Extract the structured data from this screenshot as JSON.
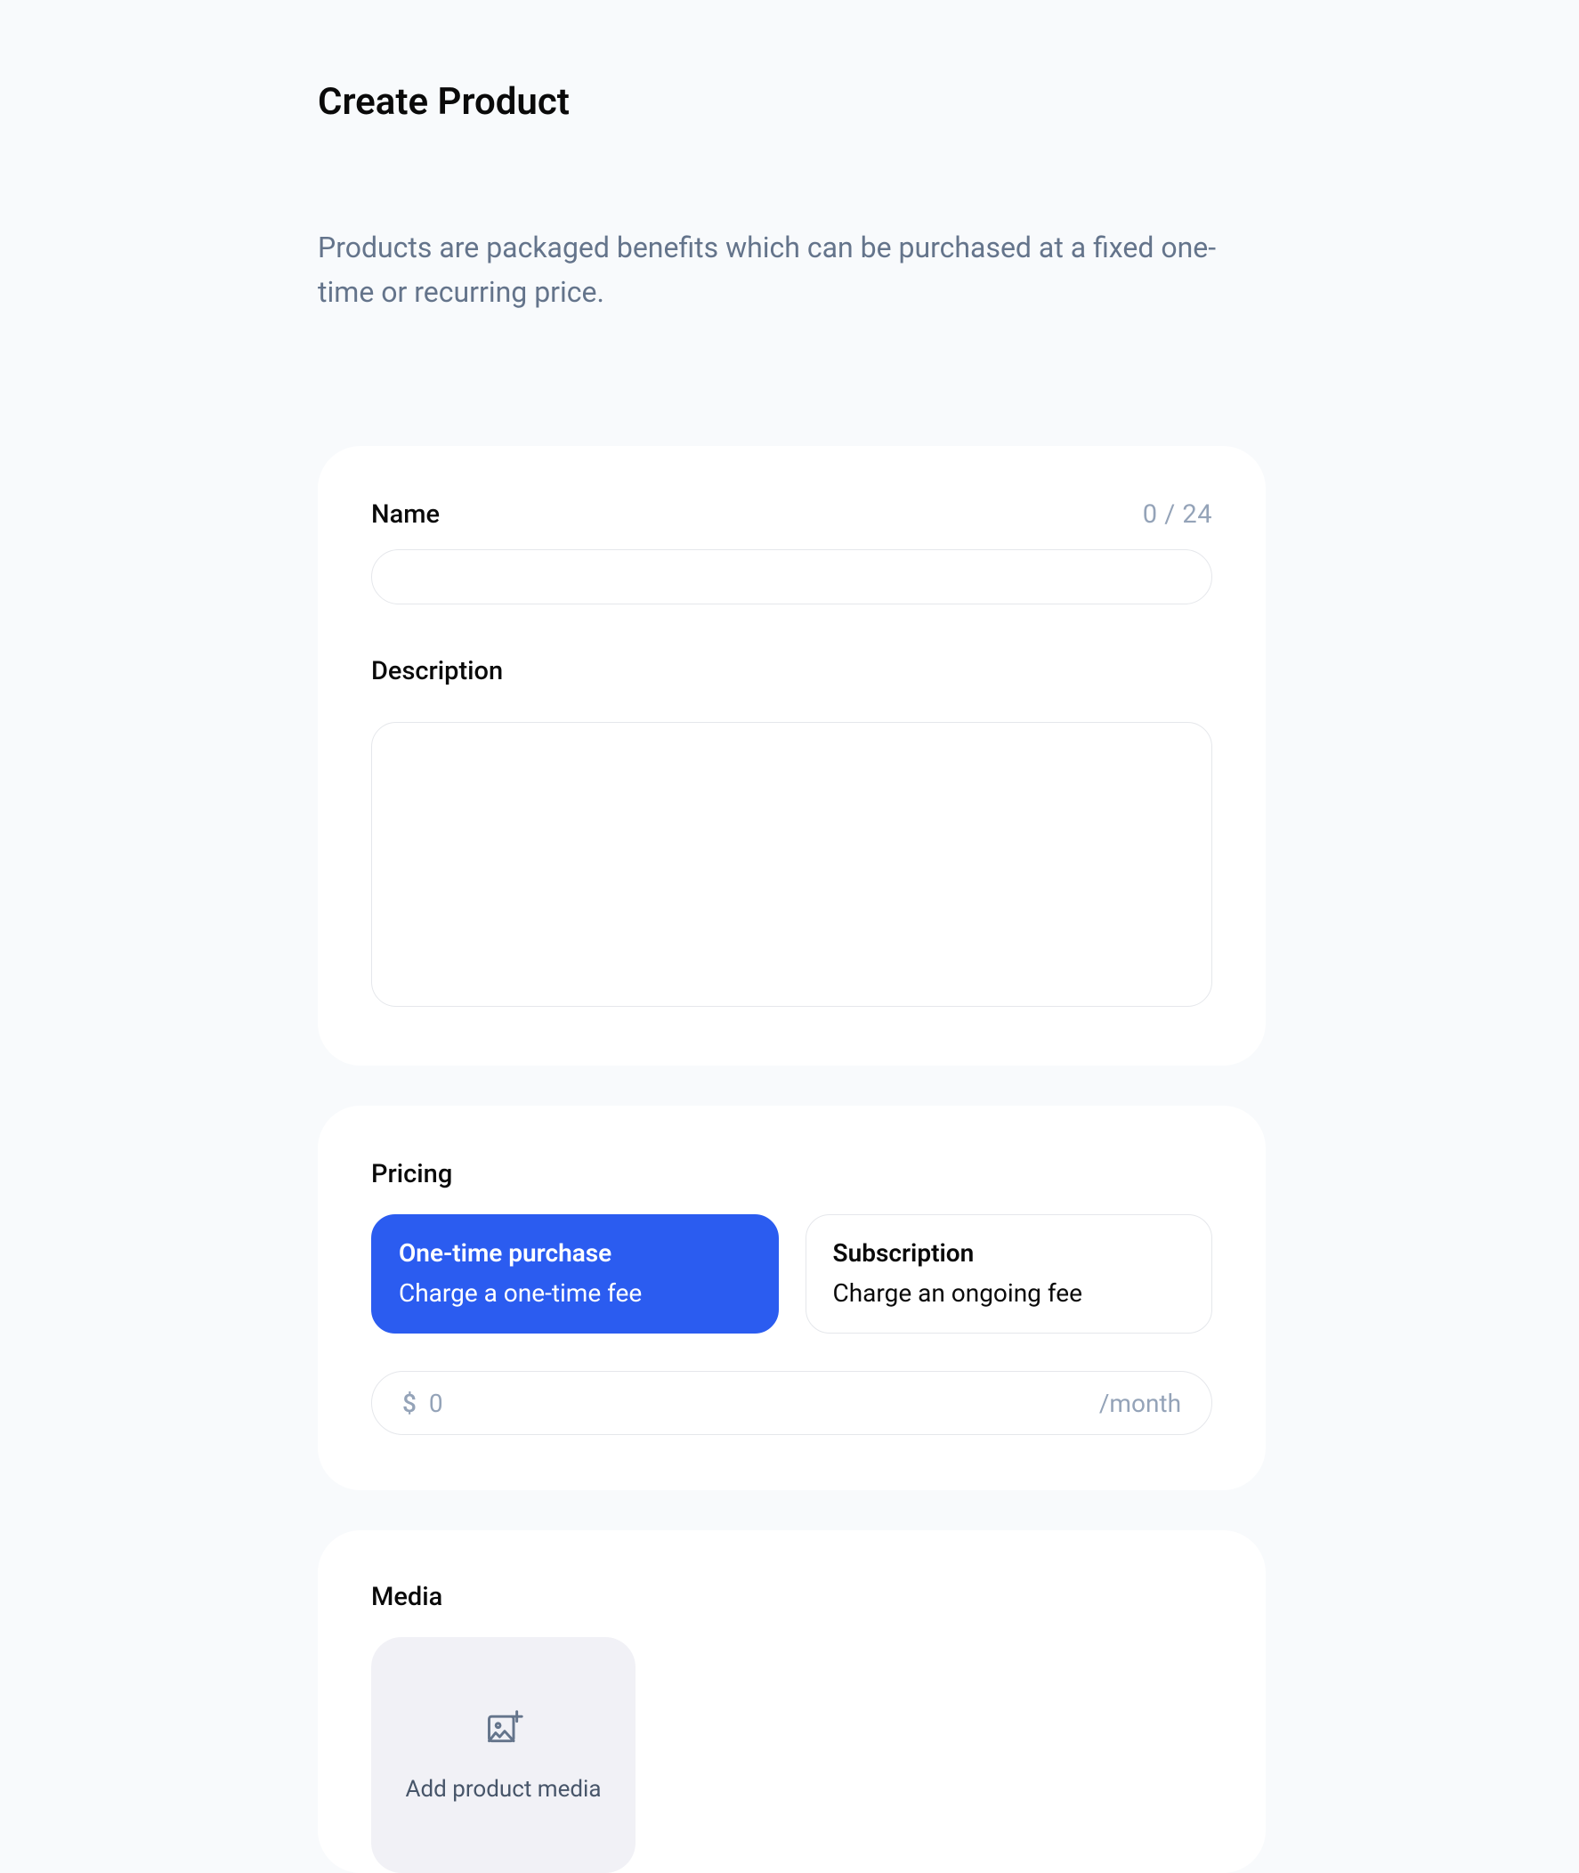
{
  "header": {
    "title": "Create Product",
    "description": "Products are packaged benefits which can be purchased at a fixed one-time or recurring price."
  },
  "basicInfo": {
    "nameLabel": "Name",
    "nameCounter": "0 / 24",
    "nameValue": "",
    "descriptionLabel": "Description",
    "descriptionValue": ""
  },
  "pricing": {
    "sectionLabel": "Pricing",
    "options": [
      {
        "title": "One-time purchase",
        "subtitle": "Charge a one-time fee",
        "selected": true
      },
      {
        "title": "Subscription",
        "subtitle": "Charge an ongoing fee",
        "selected": false
      }
    ],
    "priceCurrencySymbol": "$",
    "pricePlaceholder": "0",
    "priceValue": "",
    "priceSuffix": "/month"
  },
  "media": {
    "sectionLabel": "Media",
    "uploadText": "Add product media"
  }
}
